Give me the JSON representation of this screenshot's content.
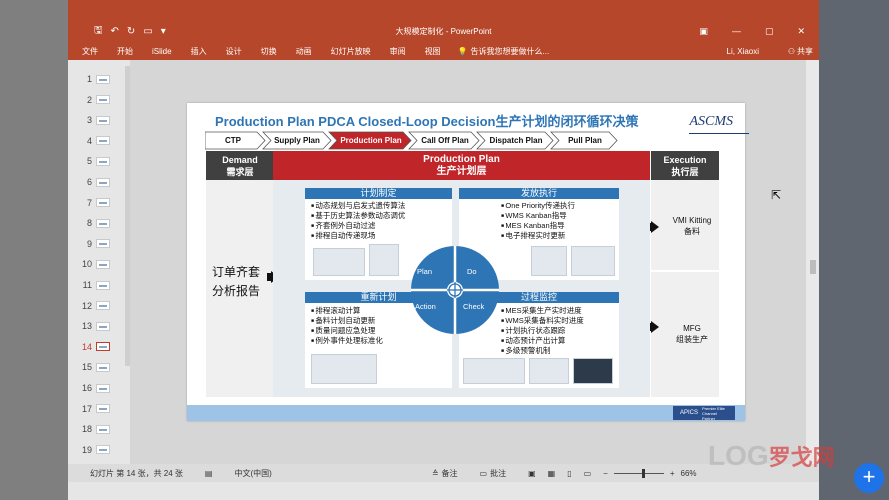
{
  "window": {
    "doc_title": "大规模定制化 - PowerPoint",
    "qat_icons": [
      "save-icon",
      "undo-icon",
      "redo-icon",
      "slideshow-icon",
      "dropdown-icon"
    ],
    "controls": [
      "minimize-icon",
      "restore-icon",
      "close-icon",
      "ribbon-options-icon"
    ]
  },
  "menu": {
    "tabs": [
      "文件",
      "开始",
      "iSlide",
      "插入",
      "设计",
      "切换",
      "动画",
      "幻灯片放映",
      "审阅",
      "视图"
    ],
    "tell_me": "告诉我您想要做什么...",
    "user": "Li, Xiaoxi",
    "share": "共享"
  },
  "thumbnails": {
    "numbers": [
      "1",
      "2",
      "3",
      "4",
      "5",
      "6",
      "7",
      "8",
      "9",
      "10",
      "11",
      "12",
      "13",
      "14",
      "15",
      "16",
      "17",
      "18",
      "19"
    ],
    "active": "14"
  },
  "slide": {
    "title": "Production Plan PDCA Closed-Loop Decision生产计划的闭环循环决策",
    "logo": "ASCMS",
    "chevrons": [
      "CTP",
      "Supply Plan",
      "Production Plan",
      "Call Off Plan",
      "Dispatch Plan",
      "Pull Plan"
    ],
    "demand_en": "Demand",
    "demand_cn": "需求层",
    "plan_en": "Production Plan",
    "plan_cn": "生产计划层",
    "exec_en": "Execution",
    "exec_cn": "执行层",
    "left_text_1": "订单齐套",
    "left_text_2": "分析报告",
    "right_1_en": "VMI Kitting",
    "right_1_cn": "备料",
    "right_2_en": "MFG",
    "right_2_cn": "组装生产",
    "q1": {
      "head": "计划制定",
      "items": [
        "动态规划与启发式遗传算法",
        "基于历史算法参数动态调优",
        "齐套例外自动过滤",
        "排程自动传递现场"
      ]
    },
    "q2": {
      "head": "发放执行",
      "items": [
        "One Priority传递执行",
        "WMS Kanban指导",
        "MES Kanban指导",
        "电子排程实时更新"
      ]
    },
    "q3": {
      "head": "重新计划",
      "items": [
        "排程滚动计算",
        "备料计划自动更新",
        "质量问题应急处理",
        "例外事件处理标准化"
      ]
    },
    "q4": {
      "head": "过程监控",
      "items": [
        "MES采集生产实时进度",
        "WMS采集备料实时进度",
        "计划执行状态跟踪",
        "动态预计产出计算",
        "多级预警机制"
      ]
    },
    "pdca": {
      "plan": "Plan",
      "do": "Do",
      "action": "Action",
      "check": "Check"
    },
    "apics_1": "APICS",
    "apics_2": "Premier Elite Channel Partner"
  },
  "status": {
    "slide_info": "幻灯片 第 14 张，共 24 张",
    "lang": "中文(中国)",
    "notes": "备注",
    "comments": "批注",
    "zoom": "66%"
  },
  "watermark": {
    "latin": "LOG",
    "cn": "罗戈网"
  },
  "colors": {
    "ppt_red": "#b7472a",
    "slide_blue": "#2e75b6",
    "band_red": "#c0252a",
    "dark_gray": "#404040"
  }
}
